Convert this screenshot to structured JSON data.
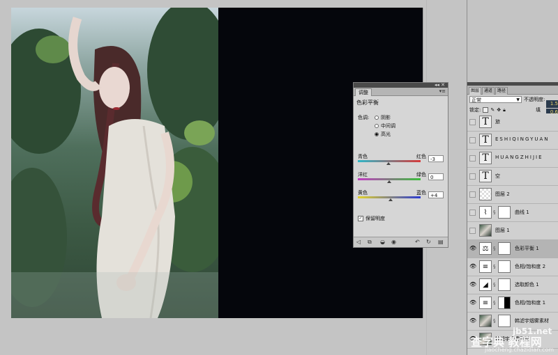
{
  "adjustments_panel": {
    "tab": "调整",
    "title": "色彩平衡",
    "tone_label": "色调:",
    "tones": [
      "阴影",
      "中间调",
      "高光"
    ],
    "selected_tone": "高光",
    "sliders": [
      {
        "left": "青色",
        "right": "红色",
        "value": "-3",
        "level": -3
      },
      {
        "left": "洋红",
        "right": "绿色",
        "value": "0",
        "level": 0
      },
      {
        "left": "黄色",
        "right": "蓝色",
        "value": "+4",
        "level": 4
      }
    ],
    "preserve_label": "保留明度",
    "preserve_checked": true
  },
  "layers_panel": {
    "tabs": [
      "图层",
      "通道",
      "路径"
    ],
    "blend_mode": "正常",
    "opacity_label": "不透明度:",
    "opacity_value_fragment": "1.5",
    "lock_label": "锁定:",
    "fill_label": "填",
    "fill_value_fragment": "0.6",
    "layers": [
      {
        "name": "旅",
        "type": "text",
        "visible": false,
        "mask": false
      },
      {
        "name": "ESHIQINGYUAN",
        "type": "text",
        "visible": false,
        "mask": false
      },
      {
        "name": "HUANGZHIJIE",
        "type": "text",
        "visible": false,
        "mask": false
      },
      {
        "name": "空",
        "type": "text",
        "visible": false,
        "mask": false
      },
      {
        "name": "图层 2",
        "type": "pixel",
        "visible": false,
        "mask": false
      },
      {
        "name": "曲线 1",
        "type": "curves",
        "visible": false,
        "mask": true
      },
      {
        "name": "图层 1",
        "type": "photo",
        "visible": false,
        "mask": false
      },
      {
        "name": "色彩平衡 1",
        "type": "balance",
        "visible": true,
        "mask": true,
        "selected": true
      },
      {
        "name": "色相/饱和度 2",
        "type": "huesat",
        "visible": true,
        "mask": true
      },
      {
        "name": "选取颜色 1",
        "type": "selective",
        "visible": true,
        "mask": true
      },
      {
        "name": "色相/饱和度 1",
        "type": "huesat",
        "visible": true,
        "mask": true,
        "mask_dark": true
      },
      {
        "name": "韩滤宇烟雾素材",
        "type": "photo",
        "visible": true,
        "mask": true
      },
      {
        "name": "韩滤宇烟雾素材",
        "type": "photo",
        "visible": true,
        "mask": false
      }
    ]
  },
  "watermark": {
    "line1": "jb51.net",
    "line2": "查字典 教程网",
    "line3": "jiaocheng.chazidian.com"
  },
  "colors": {
    "canvas": "#05060c",
    "workspace": "#c4c4c4",
    "panel": "#d0d0d0"
  }
}
